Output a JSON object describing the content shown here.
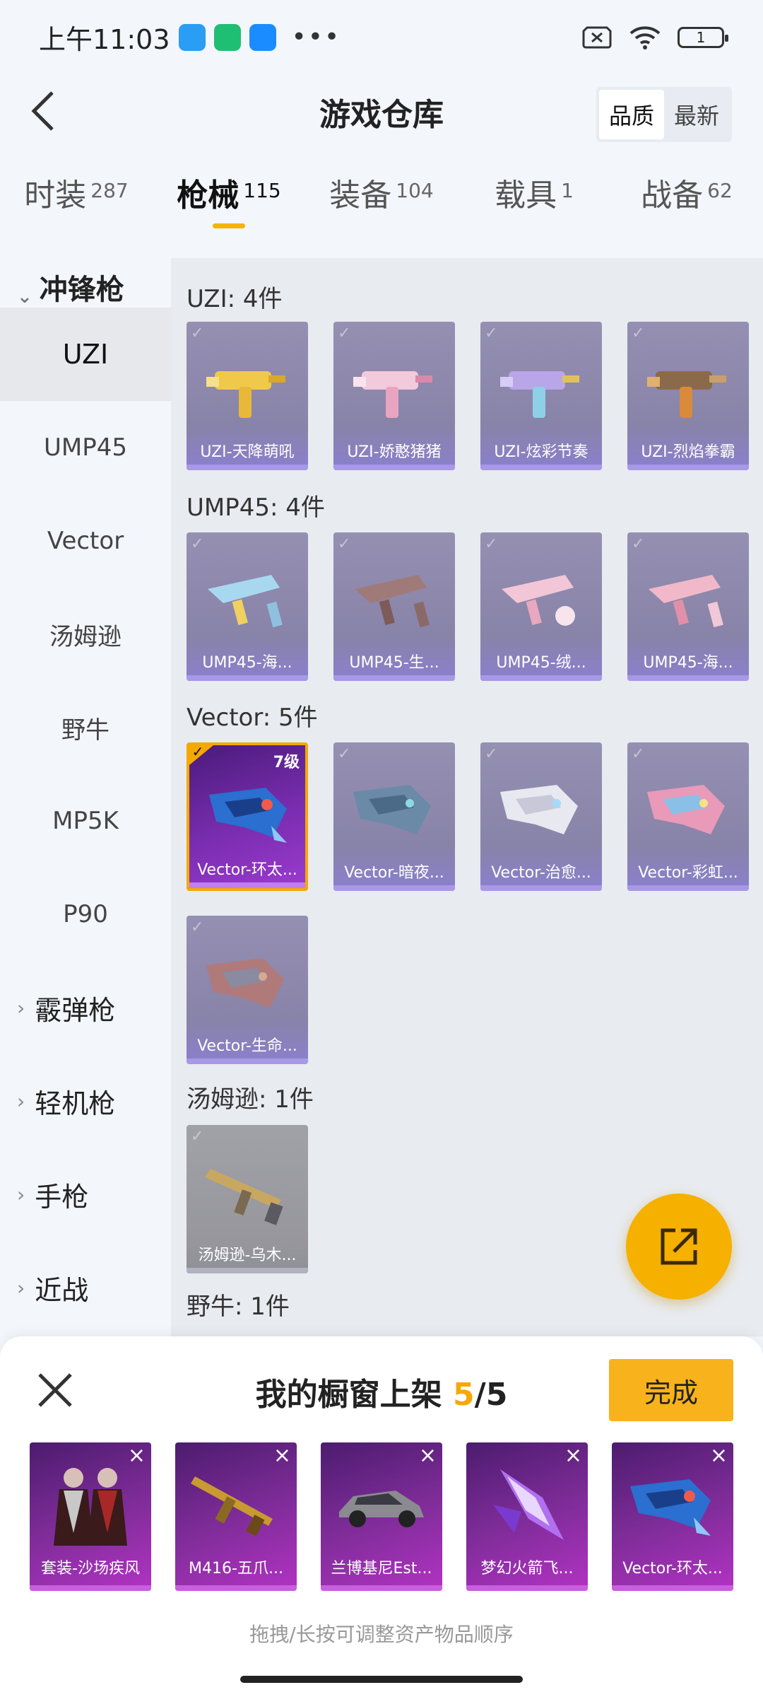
{
  "status_bar": {
    "time": "上午11:03",
    "battery": "1"
  },
  "header": {
    "title": "游戏仓库",
    "sort_quality": "品质",
    "sort_latest": "最新"
  },
  "tabs": [
    {
      "label": "时装",
      "count": "287"
    },
    {
      "label": "枪械",
      "count": "115"
    },
    {
      "label": "装备",
      "count": "104"
    },
    {
      "label": "载具",
      "count": "1"
    },
    {
      "label": "战备",
      "count": "62"
    }
  ],
  "sidebar": {
    "group_label": "冲锋枪",
    "items": [
      "UZI",
      "UMP45",
      "Vector",
      "汤姆逊",
      "野牛",
      "MP5K",
      "P90"
    ],
    "categories": [
      "霰弹枪",
      "轻机枪",
      "手枪",
      "近战"
    ]
  },
  "sections": {
    "uzi": {
      "title": "UZI: 4件",
      "items": [
        "UZI-天降萌吼",
        "UZI-娇憨猪猪",
        "UZI-炫彩节奏",
        "UZI-烈焰拳霸"
      ]
    },
    "ump45": {
      "title": "UMP45: 4件",
      "items": [
        "UMP45-海...",
        "UMP45-生...",
        "UMP45-绒...",
        "UMP45-海..."
      ]
    },
    "vector": {
      "title": "Vector: 5件",
      "level": "7级",
      "items": [
        "Vector-环太...",
        "Vector-暗夜...",
        "Vector-治愈...",
        "Vector-彩虹...",
        "Vector-生命..."
      ]
    },
    "thompson": {
      "title": "汤姆逊: 1件",
      "items": [
        "汤姆逊-乌木..."
      ]
    },
    "bison": {
      "title": "野牛: 1件"
    }
  },
  "panel": {
    "title": "我的橱窗上架",
    "count": "5",
    "total": "/5",
    "done_label": "完成",
    "items": [
      "套装-沙场疾风",
      "M416-五爪...",
      "兰博基尼Est...",
      "梦幻火箭飞...",
      "Vector-环太..."
    ],
    "hint": "拖拽/长按可调整资产物品顺序"
  },
  "colors": {
    "accent": "#f5b000",
    "selected_card": "#7a2db0"
  }
}
